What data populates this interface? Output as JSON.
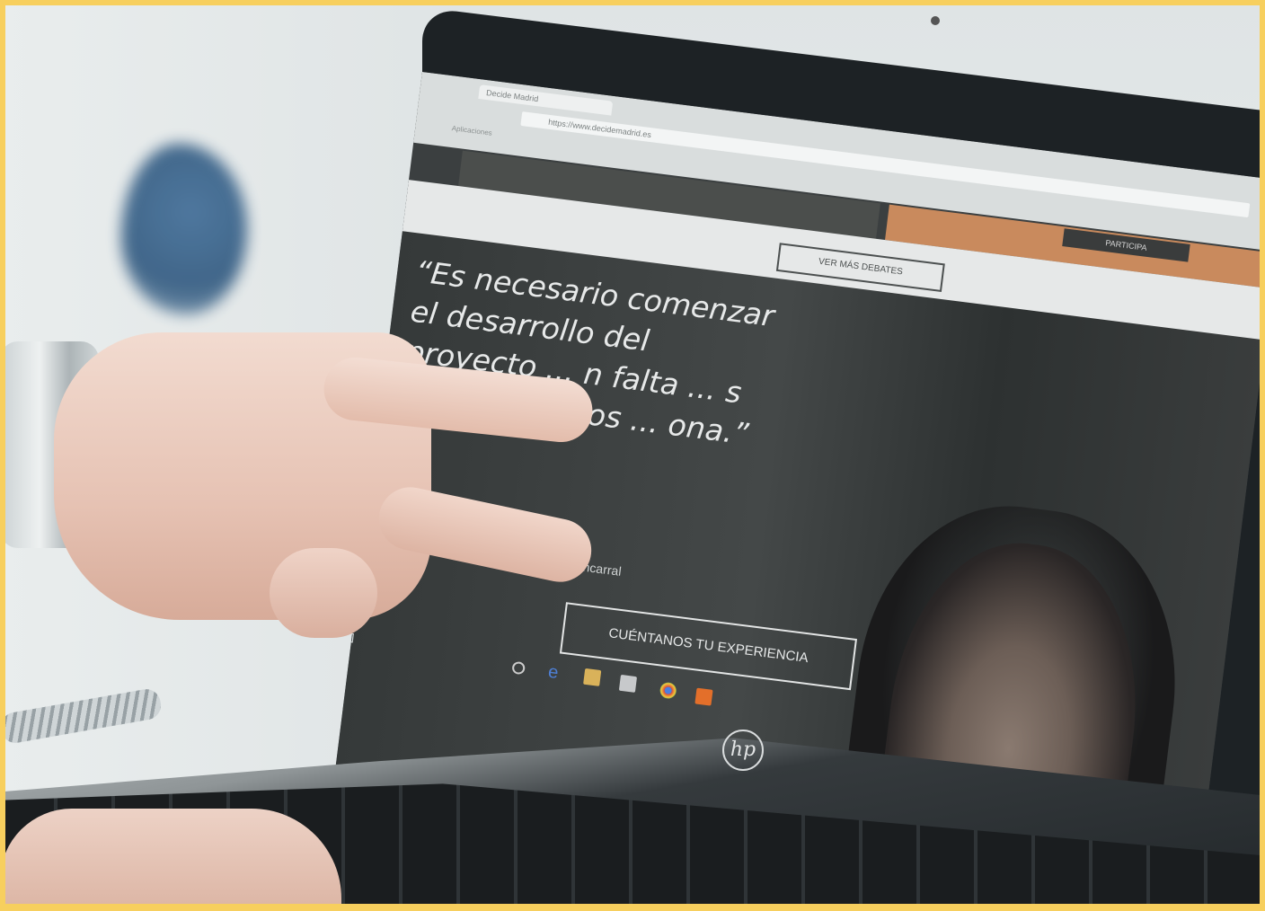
{
  "browser": {
    "tab_title": "Decide Madrid",
    "url": "https://www.decidemadrid.es",
    "bookmarks": "Aplicaciones"
  },
  "site": {
    "participa_button": "PARTICIPA",
    "ver_mas_button": "VER MÁS DEBATES",
    "quote": "“Es necesario comenzar el desarrollo del proyecto ... n falta ... s equipamientos ... ona.”",
    "author": "de Fuencarral",
    "cta_button": "CUÉNTANOS TU EXPERIENCIA"
  },
  "device": {
    "brand": "hp"
  },
  "colors": {
    "frame": "#f7cf5e",
    "orange_bar": "#c98a5d",
    "dark_bar": "#4b4e4c"
  }
}
